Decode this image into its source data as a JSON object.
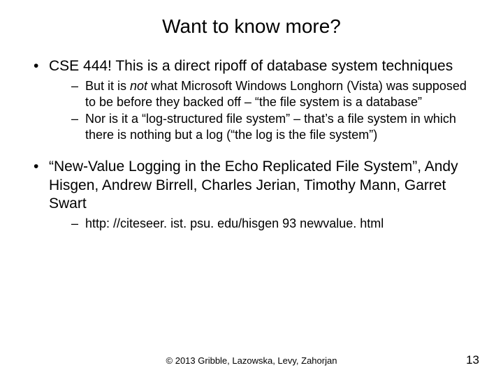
{
  "title": "Want to know more?",
  "bullets": {
    "b1": {
      "text": "CSE 444!  This is a direct ripoff of database system techniques",
      "sub": {
        "s1_pre": "But it is ",
        "s1_em": "not",
        "s1_post": " what Microsoft Windows Longhorn (Vista) was supposed to be before they backed off – “the file system is a database”",
        "s2": "Nor is it a “log-structured file system” – that’s a file system in which there is nothing but a log (“the log is the file system”)"
      }
    },
    "b2": {
      "text": "“New-Value Logging in the Echo Replicated File System”, Andy Hisgen, Andrew Birrell, Charles Jerian, Timothy Mann, Garret Swart",
      "sub": {
        "s1": "http: //citeseer. ist. psu. edu/hisgen 93 newvalue. html"
      }
    }
  },
  "footer": "© 2013 Gribble, Lazowska, Levy, Zahorjan",
  "page_number": "13"
}
